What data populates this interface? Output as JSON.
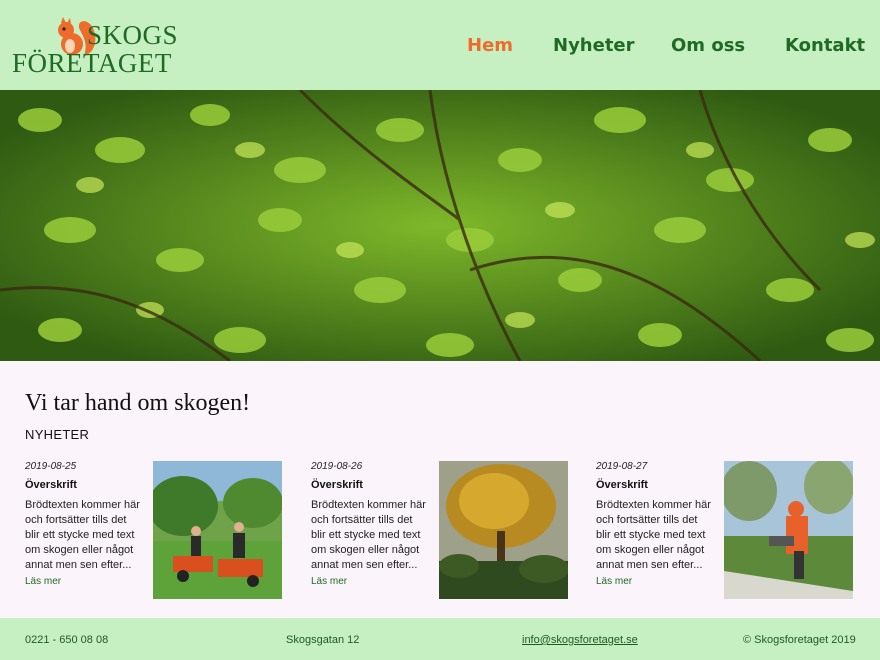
{
  "header": {
    "logo_line1": "SKOGS",
    "logo_line2": "FÖRETAGET",
    "nav": [
      {
        "label": "Hem"
      },
      {
        "label": "Nyheter"
      },
      {
        "label": "Om oss"
      },
      {
        "label": "Kontakt"
      }
    ]
  },
  "main": {
    "headline": "Vi tar hand om skogen!",
    "section_title": "NYHETER",
    "news": [
      {
        "date": "2019-08-25",
        "title": "Överskrift",
        "body": "Brödtexten kommer här och fortsätter tills det blir ett stycke med text om skogen eller något annat men sen efter...",
        "more": "Läs mer"
      },
      {
        "date": "2019-08-26",
        "title": "Överskrift",
        "body": "Brödtexten kommer här och fortsätter tills det blir ett stycke med text om skogen eller något annat men sen efter...",
        "more": "Läs mer"
      },
      {
        "date": "2019-08-27",
        "title": "Överskrift",
        "body": "Brödtexten kommer här och fortsätter tills det blir ett stycke med text om skogen eller något annat men sen efter...",
        "more": "Läs mer"
      }
    ]
  },
  "footer": {
    "phone": "0221 - 650 08 08",
    "address": "Skogsgatan 12",
    "email": "info@skogsforetaget.se",
    "copyright": "© Skogsforetaget 2019"
  },
  "colors": {
    "header_bg": "#c6f0c1",
    "brand_green": "#1f6a25",
    "active_nav": "#ef6b2c",
    "page_bg": "#fbf4fb"
  }
}
